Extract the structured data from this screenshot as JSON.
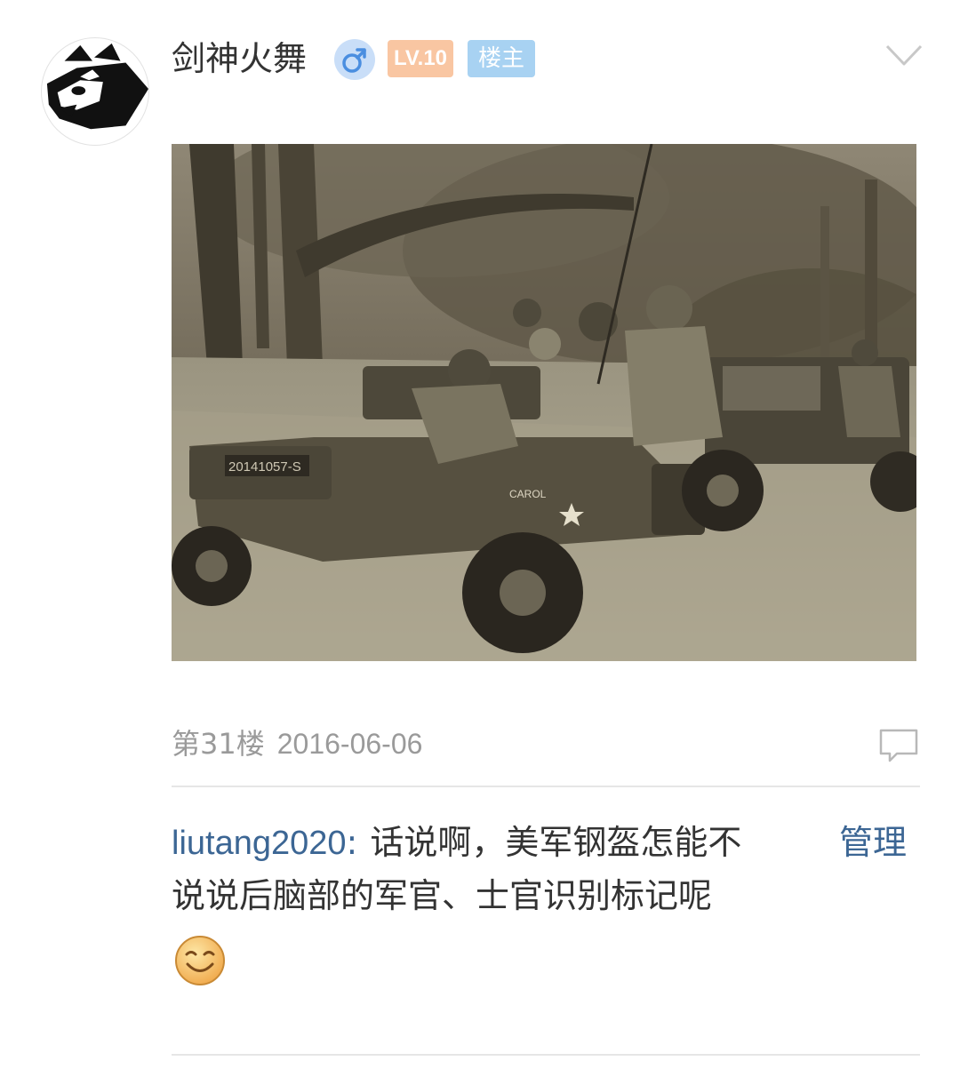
{
  "post": {
    "author": {
      "name": "剑神火舞",
      "gender_icon": "male-icon",
      "level_badge": "LV.10",
      "owner_badge": "楼主",
      "avatar_icon": "panda-avatar"
    },
    "image": {
      "icon": "jeep-soldiers-photo",
      "plate_text": "20141057-S",
      "vehicle_name_text": "CAROL"
    },
    "floor": "第31楼",
    "date": "2016-06-06",
    "reply": {
      "user": "liutang2020",
      "separator": ":",
      "line1": "话说啊，美军钢盔怎能不",
      "line2": "说说后脑部的军官、士官识别标记呢",
      "manage_label": "管理",
      "emoji_icon": "smile-emoji"
    }
  },
  "colors": {
    "link_blue": "#3c6694",
    "level_badge": "#f9c6a2",
    "owner_badge": "#a8d2f2",
    "gender_circle": "#c9def8",
    "meta_gray": "#9a9a9a"
  }
}
